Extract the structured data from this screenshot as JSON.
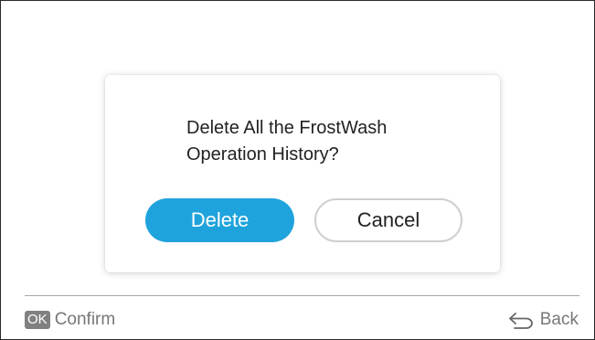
{
  "dialog": {
    "message": "Delete All the FrostWash\nOperation History?",
    "delete_label": "Delete",
    "cancel_label": "Cancel"
  },
  "footer": {
    "ok_badge": "OK",
    "confirm_label": "Confirm",
    "back_label": "Back",
    "back_icon": "back-arrow-icon"
  },
  "colors": {
    "accent": "#1fa3dc",
    "text": "#222222",
    "muted": "#777777",
    "badge": "#808080"
  }
}
